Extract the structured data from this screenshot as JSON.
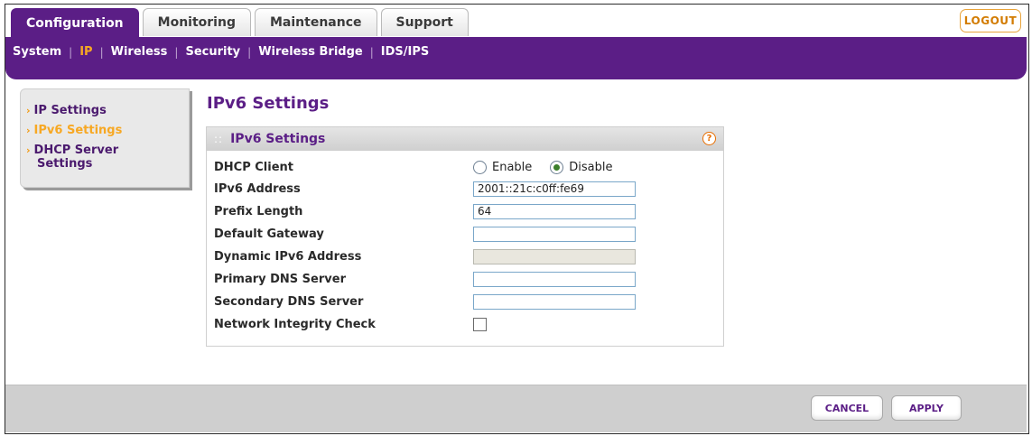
{
  "tabs": [
    "Configuration",
    "Monitoring",
    "Maintenance",
    "Support"
  ],
  "logout_label": "LOGOUT",
  "subnav": [
    "System",
    "IP",
    "Wireless",
    "Security",
    "Wireless Bridge",
    "IDS/IPS"
  ],
  "leftmenu": {
    "items": [
      {
        "label": "IP Settings"
      },
      {
        "label": "IPv6 Settings"
      },
      {
        "label": "DHCP Server",
        "label2": "Settings"
      }
    ]
  },
  "page_title": "IPv6 Settings",
  "panel": {
    "title": "IPv6 Settings",
    "help": "?",
    "fields": {
      "dhcp_client": {
        "label": "DHCP Client",
        "option_enable": "Enable",
        "option_disable": "Disable",
        "selected": "Disable"
      },
      "ipv6_address": {
        "label": "IPv6 Address",
        "value": "2001::21c:c0ff:fe69"
      },
      "prefix_length": {
        "label": "Prefix Length",
        "value": "64"
      },
      "default_gateway": {
        "label": "Default Gateway",
        "value": ""
      },
      "dynamic_ipv6": {
        "label": "Dynamic IPv6 Address",
        "value": ""
      },
      "primary_dns": {
        "label": "Primary DNS Server",
        "value": ""
      },
      "secondary_dns": {
        "label": "Secondary DNS Server",
        "value": ""
      },
      "network_integrity": {
        "label": "Network Integrity Check",
        "checked": false
      }
    }
  },
  "buttons": {
    "cancel": "CANCEL",
    "apply": "APPLY"
  }
}
